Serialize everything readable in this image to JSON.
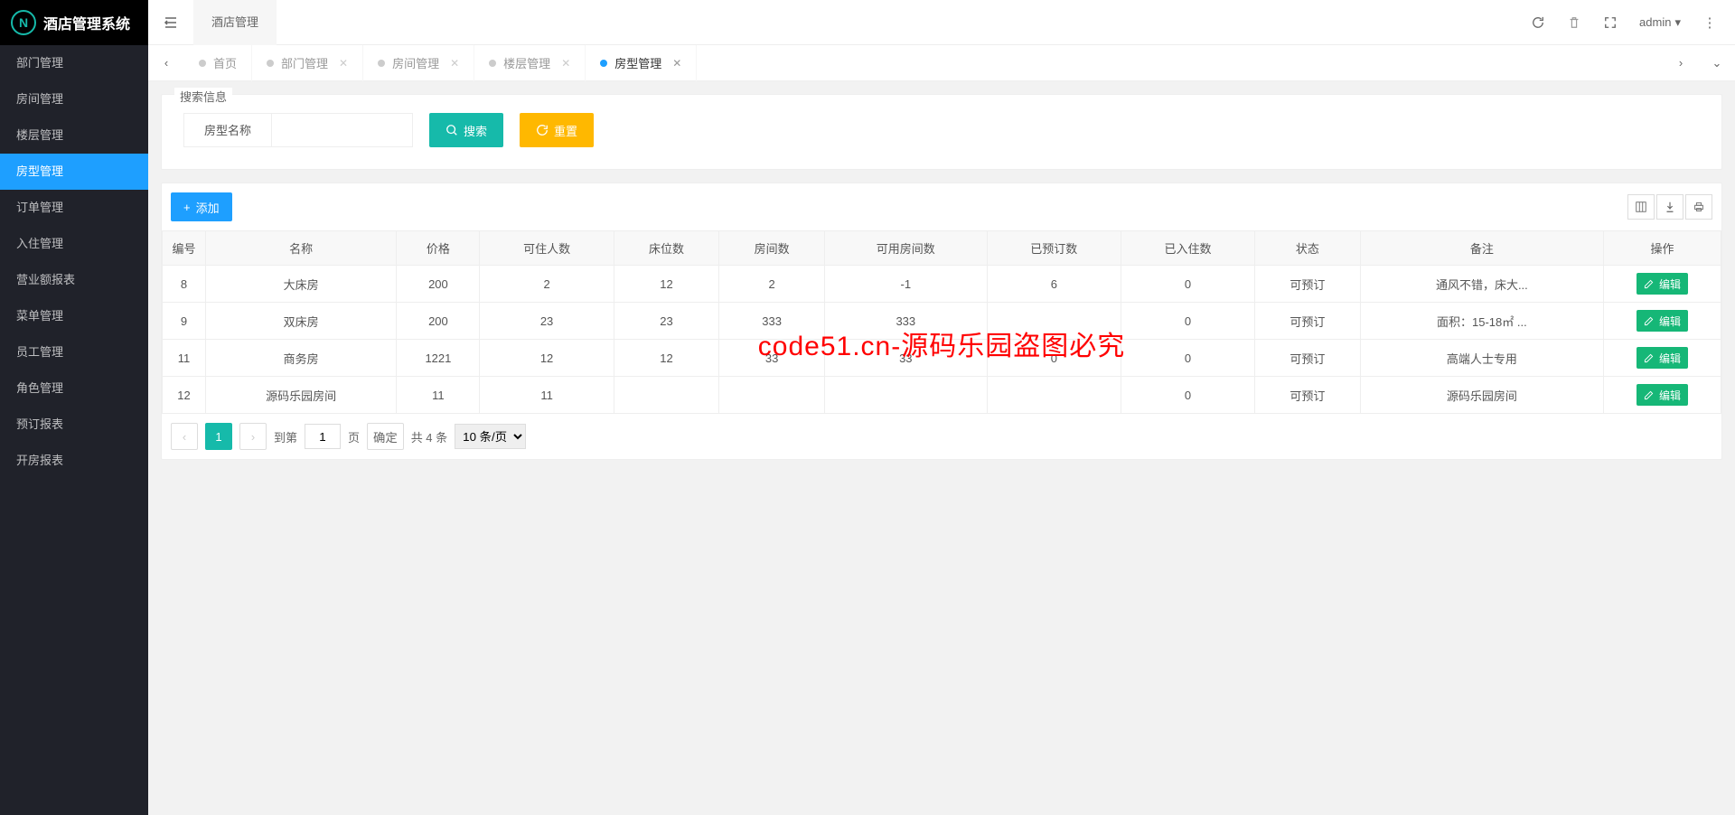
{
  "app": {
    "title": "酒店管理系统"
  },
  "sidebar": {
    "items": [
      {
        "label": "部门管理"
      },
      {
        "label": "房间管理"
      },
      {
        "label": "楼层管理"
      },
      {
        "label": "房型管理"
      },
      {
        "label": "订单管理"
      },
      {
        "label": "入住管理"
      },
      {
        "label": "营业额报表"
      },
      {
        "label": "菜单管理"
      },
      {
        "label": "员工管理"
      },
      {
        "label": "角色管理"
      },
      {
        "label": "预订报表"
      },
      {
        "label": "开房报表"
      }
    ]
  },
  "header": {
    "breadcrumb": "酒店管理",
    "user": "admin"
  },
  "tabs": {
    "items": [
      {
        "label": "首页",
        "closable": false
      },
      {
        "label": "部门管理",
        "closable": true
      },
      {
        "label": "房间管理",
        "closable": true
      },
      {
        "label": "楼层管理",
        "closable": true
      },
      {
        "label": "房型管理",
        "closable": true
      }
    ]
  },
  "search": {
    "legend": "搜索信息",
    "field_label": "房型名称",
    "search_btn": "搜索",
    "reset_btn": "重置"
  },
  "toolbar": {
    "add_btn": "添加"
  },
  "table": {
    "headers": [
      "编号",
      "名称",
      "价格",
      "可住人数",
      "床位数",
      "房间数",
      "可用房间数",
      "已预订数",
      "已入住数",
      "状态",
      "备注",
      "操作"
    ],
    "rows": [
      {
        "id": "8",
        "name": "大床房",
        "price": "200",
        "capacity": "2",
        "beds": "12",
        "rooms": "2",
        "avail": "-1",
        "booked": "6",
        "checkedin": "0",
        "status": "可预订",
        "remark": "通风不错，床大..."
      },
      {
        "id": "9",
        "name": "双床房",
        "price": "200",
        "capacity": "23",
        "beds": "23",
        "rooms": "333",
        "avail": "333",
        "booked": "",
        "checkedin": "0",
        "status": "可预订",
        "remark": "面积：15-18㎡ ..."
      },
      {
        "id": "11",
        "name": "商务房",
        "price": "1221",
        "capacity": "12",
        "beds": "12",
        "rooms": "33",
        "avail": "33",
        "booked": "0",
        "checkedin": "0",
        "status": "可预订",
        "remark": "高端人士专用"
      },
      {
        "id": "12",
        "name": "源码乐园房间",
        "price": "11",
        "capacity": "11",
        "beds": "",
        "rooms": "",
        "avail": "",
        "booked": "",
        "checkedin": "0",
        "status": "可预订",
        "remark": "源码乐园房间"
      }
    ],
    "edit_btn": "编辑"
  },
  "pagination": {
    "current": "1",
    "goto_label": "到第",
    "goto_value": "1",
    "page_label": "页",
    "confirm": "确定",
    "total": "共 4 条",
    "per_page": "10 条/页"
  },
  "watermark": "code51.cn-源码乐园盗图必究"
}
